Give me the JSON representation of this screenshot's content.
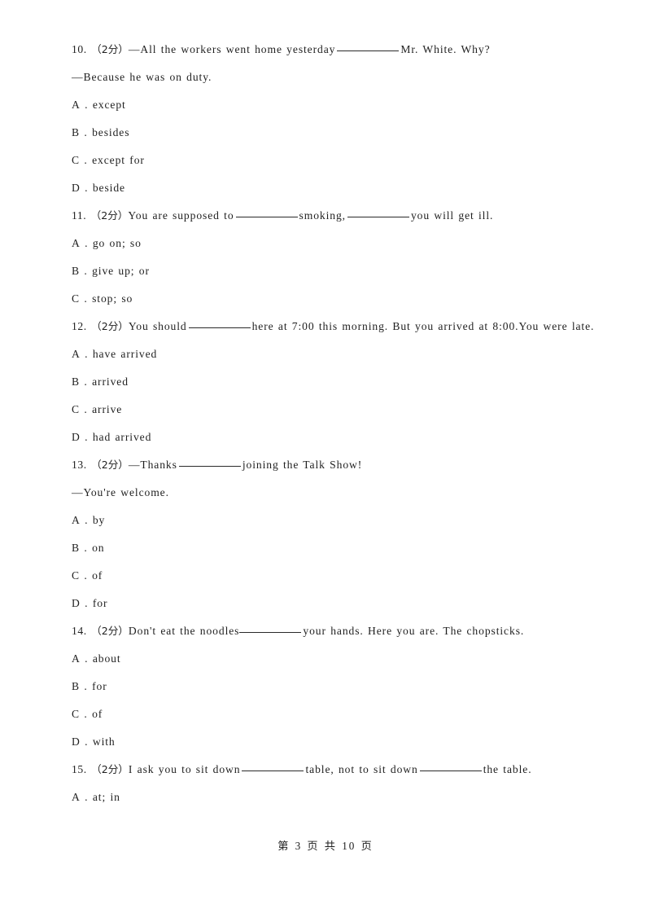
{
  "document": {
    "page_label_prefix": "第",
    "page_number": "3",
    "page_label_middle": "页 共",
    "page_total": "10",
    "page_label_suffix": "页",
    "footer_text": "第 3 页 共 10 页"
  },
  "questions": [
    {
      "number": "10.",
      "marks": "（2分）",
      "stem_before": "—All the workers went home yesterday",
      "stem_after": "Mr. White. Why?",
      "reply": "—Because he was on duty.",
      "options": [
        {
          "label": "A",
          "sep": ".",
          "text": "except"
        },
        {
          "label": "B",
          "sep": ".",
          "text": "besides"
        },
        {
          "label": "C",
          "sep": ".",
          "text": "except for"
        },
        {
          "label": "D",
          "sep": ".",
          "text": "beside"
        }
      ]
    },
    {
      "number": "11.",
      "marks": "（2分）",
      "stem_before": "You are supposed to",
      "stem_middle": "smoking,",
      "stem_after": "you will get ill.",
      "options": [
        {
          "label": "A",
          "sep": ".",
          "text": "go on; so"
        },
        {
          "label": "B",
          "sep": ".",
          "text": "give up; or"
        },
        {
          "label": "C",
          "sep": ".",
          "text": "stop; so"
        }
      ]
    },
    {
      "number": "12.",
      "marks": "（2分）",
      "stem_before": "You should",
      "stem_after": "here at 7:00 this morning. But you arrived at 8:00.You were late.",
      "options": [
        {
          "label": "A",
          "sep": ".",
          "text": "have arrived"
        },
        {
          "label": "B",
          "sep": ".",
          "text": "arrived"
        },
        {
          "label": "C",
          "sep": ".",
          "text": "arrive"
        },
        {
          "label": "D",
          "sep": ".",
          "text": "had arrived"
        }
      ]
    },
    {
      "number": "13.",
      "marks": "（2分）",
      "stem_before": "—Thanks",
      "stem_after": "joining the Talk Show!",
      "reply": "—You're welcome.",
      "options": [
        {
          "label": "A",
          "sep": ".",
          "text": "by"
        },
        {
          "label": "B",
          "sep": ".",
          "text": "on"
        },
        {
          "label": "C",
          "sep": ".",
          "text": "of"
        },
        {
          "label": "D",
          "sep": ".",
          "text": "for"
        }
      ]
    },
    {
      "number": "14.",
      "marks": "（2分）",
      "stem_before": "Don't eat the noodles",
      "stem_after": "your hands. Here you are. The chopsticks.",
      "options": [
        {
          "label": "A",
          "sep": ".",
          "text": "about"
        },
        {
          "label": "B",
          "sep": ".",
          "text": "for"
        },
        {
          "label": "C",
          "sep": ".",
          "text": "of"
        },
        {
          "label": "D",
          "sep": ".",
          "text": "with"
        }
      ]
    },
    {
      "number": "15.",
      "marks": "（2分）",
      "stem_before": "I ask you to sit down",
      "stem_middle": "table, not to sit down",
      "stem_after": "the table.",
      "options": [
        {
          "label": "A",
          "sep": ".",
          "text": "at; in"
        }
      ]
    }
  ]
}
